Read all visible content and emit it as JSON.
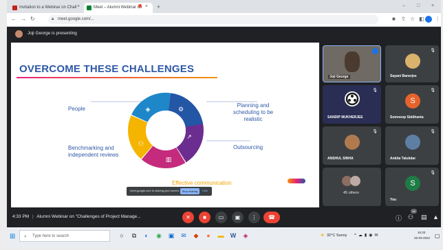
{
  "browser": {
    "tabs": [
      {
        "title": "Invitation to a Webinar on Chall",
        "active": false
      },
      {
        "title": "Meet – Alumni Webinar on",
        "active": true
      }
    ],
    "url": "meet.google.com/...",
    "window_controls": [
      "–",
      "□",
      "×"
    ]
  },
  "meet": {
    "presenting_label": "Joji George is presenting",
    "time": "4:33 PM",
    "separator": "|",
    "meeting_title": "Alumni Webinar on \"Challenges of Project Manage...",
    "share_bar": {
      "text": "meet.google.com is sharing your screen.",
      "stop": "Stop sharing",
      "hide": "Hide"
    }
  },
  "slide": {
    "title": "OVERCOME THESE CHALLENGES",
    "left_labels": [
      "People",
      "Benchmarking and independent reviews"
    ],
    "right_labels": [
      "Planning and scheduling to be realistic",
      "Outsourcing"
    ],
    "bottom_label": "Effective communication",
    "wheel_colors": [
      "#6b2d8f",
      "#c42b7c",
      "#f5b400",
      "#1d87c9",
      "#2356a5"
    ]
  },
  "participants": [
    {
      "name": "Joji George",
      "initial": "",
      "color": "#7a5a48",
      "type": "video"
    },
    {
      "name": "Sayani Banerjee",
      "initial": "",
      "color": "#d9b36b",
      "type": "photo"
    },
    {
      "name": "SANDIP MUKHERJEE",
      "initial": "",
      "color": "#ffffff",
      "type": "logo"
    },
    {
      "name": "Somnoop Siddhanta",
      "initial": "S",
      "color": "#e8622c",
      "type": "initial"
    },
    {
      "name": "ANSHUL SINHA",
      "initial": "",
      "color": "#b07a4f",
      "type": "photo"
    },
    {
      "name": "Ankita Talukdar",
      "initial": "",
      "color": "#5e7fa3",
      "type": "photo"
    },
    {
      "name": "45 others",
      "initial": "",
      "color": "#9e9e9e",
      "type": "others"
    },
    {
      "name": "You",
      "initial": "S",
      "color": "#1e7c45",
      "type": "initial"
    }
  ],
  "controls": [
    {
      "name": "mic-off",
      "glyph": "✕",
      "color": "#ea4335"
    },
    {
      "name": "camera-off",
      "glyph": "■",
      "color": "#ea4335"
    },
    {
      "name": "captions",
      "glyph": "▭",
      "color": "#3c4043"
    },
    {
      "name": "present",
      "glyph": "▣",
      "color": "#3c4043"
    },
    {
      "name": "more",
      "glyph": "⋮",
      "color": "#3c4043"
    },
    {
      "name": "leave",
      "glyph": "☎",
      "color": "#ea4335"
    }
  ],
  "right_controls": [
    {
      "name": "info",
      "glyph": "ⓘ"
    },
    {
      "name": "people",
      "glyph": "⚇",
      "badge": "48"
    },
    {
      "name": "chat",
      "glyph": "▤"
    },
    {
      "name": "activities",
      "glyph": "▲"
    }
  ],
  "taskbar": {
    "search_placeholder": "Type here to search",
    "weather": "32°C Sunny",
    "clock_time": "16:33",
    "clock_date": "26-03-2022",
    "app_icons": [
      {
        "name": "cortana",
        "glyph": "○",
        "color": "#202124"
      },
      {
        "name": "task-view",
        "glyph": "⧉",
        "color": "#202124"
      },
      {
        "name": "edge",
        "glyph": "◐",
        "color": "#1a73e8"
      },
      {
        "name": "chrome",
        "glyph": "◉",
        "color": "#34a853"
      },
      {
        "name": "store",
        "glyph": "▣",
        "color": "#0b6cd0"
      },
      {
        "name": "mail",
        "glyph": "✉",
        "color": "#0b6cd0"
      },
      {
        "name": "photos",
        "glyph": "◆",
        "color": "#d83b01"
      },
      {
        "name": "firefox",
        "glyph": "●",
        "color": "#ff7139"
      },
      {
        "name": "files",
        "glyph": "▬",
        "color": "#f0b400"
      },
      {
        "name": "word",
        "glyph": "W",
        "color": "#2b5797"
      },
      {
        "name": "app",
        "glyph": "◈",
        "color": "#c2185b"
      }
    ]
  }
}
